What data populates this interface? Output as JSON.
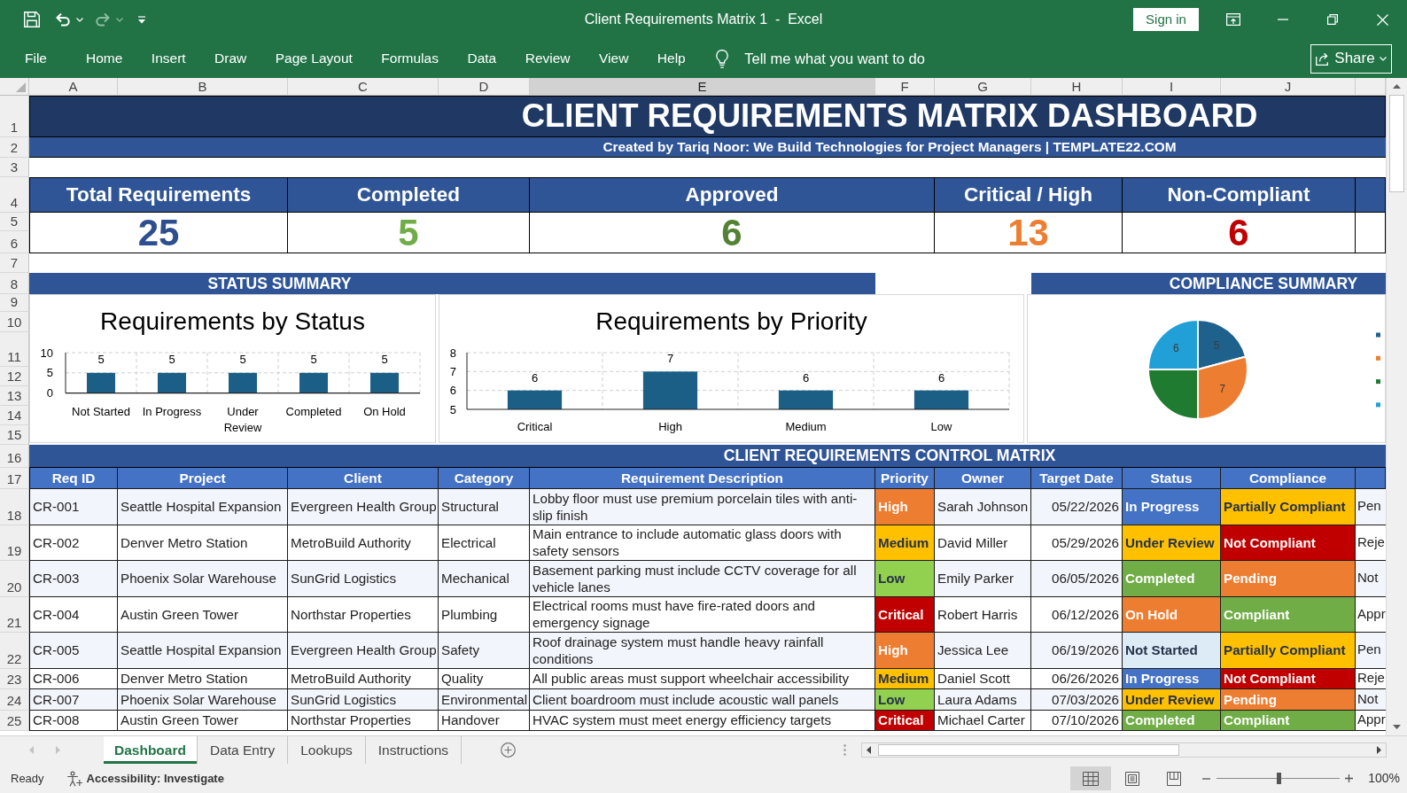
{
  "window": {
    "title": "Client Requirements Matrix 1  -  Excel",
    "sign_in": "Sign in"
  },
  "quick_access": [
    {
      "kind": "save",
      "disabled": false
    },
    {
      "kind": "undo",
      "disabled": false
    },
    {
      "kind": "redo",
      "disabled": true
    },
    {
      "kind": "customize",
      "disabled": false
    }
  ],
  "ribbon": {
    "tabs": [
      {
        "label": "File",
        "selected": false
      },
      {
        "label": "Home",
        "selected": false
      },
      {
        "label": "Insert",
        "selected": false
      },
      {
        "label": "Draw",
        "selected": false
      },
      {
        "label": "Page Layout",
        "selected": false
      },
      {
        "label": "Formulas",
        "selected": false
      },
      {
        "label": "Data",
        "selected": false
      },
      {
        "label": "Review",
        "selected": false
      },
      {
        "label": "View",
        "selected": false
      },
      {
        "label": "Help",
        "selected": false
      }
    ],
    "tell_me": "Tell me what you want to do",
    "share": "Share"
  },
  "sheet": {
    "column_headers": [
      {
        "label": "A",
        "selected": false
      },
      {
        "label": "B",
        "selected": false
      },
      {
        "label": "C",
        "selected": false
      },
      {
        "label": "D",
        "selected": false
      },
      {
        "label": "E",
        "selected": true
      },
      {
        "label": "F",
        "selected": false
      },
      {
        "label": "G",
        "selected": false
      },
      {
        "label": "H",
        "selected": false
      },
      {
        "label": "I",
        "selected": false
      },
      {
        "label": "J",
        "selected": false
      }
    ],
    "row_numbers": [
      "1",
      "2",
      "3",
      "4",
      "5",
      "6",
      "7",
      "8",
      "9",
      "10",
      "11",
      "12",
      "13",
      "14",
      "15",
      "16",
      "17",
      "18",
      "19",
      "20",
      "21",
      "22",
      "23",
      "24",
      "25"
    ],
    "title": "CLIENT REQUIREMENTS MATRIX DASHBOARD",
    "subtitle": "Created by Tariq Noor: We Build Technologies for Project Managers | TEMPLATE22.COM",
    "kpis": [
      {
        "label": "Total Requirements",
        "value": "25",
        "color": "#2e4f8f"
      },
      {
        "label": "Completed",
        "value": "5",
        "color": "#70ad47"
      },
      {
        "label": "Approved",
        "value": "6",
        "color": "#548235"
      },
      {
        "label": "Critical / High",
        "value": "13",
        "color": "#ed7d31"
      },
      {
        "label": "Non-Compliant",
        "value": "6",
        "color": "#c00000"
      }
    ],
    "status_summary": {
      "title": "STATUS SUMMARY",
      "status_chart": {
        "chart_data": {
          "type": "bar",
          "title": "Requirements by Status",
          "categories": [
            "Not Started",
            "In Progress",
            "Under Review",
            "Completed",
            "On Hold"
          ],
          "series": [
            {
              "color": "#1c5f86",
              "values": [
                5,
                5,
                5,
                5,
                5
              ]
            }
          ],
          "ylim": [
            0,
            10
          ],
          "yticks": [
            0,
            5,
            10
          ],
          "data_labels": true
        }
      },
      "priority_chart": {
        "chart_data": {
          "type": "bar",
          "title": "Requirements by Priority",
          "categories": [
            "Critical",
            "High",
            "Medium",
            "Low"
          ],
          "series": [
            {
              "color": "#1c5f86",
              "values": [
                6,
                7,
                6,
                6
              ]
            }
          ],
          "ylim": [
            5,
            8
          ],
          "yticks": [
            5,
            6,
            7,
            8
          ],
          "data_labels": true
        }
      }
    },
    "compliance_summary": {
      "title": "COMPLIANCE SUMMARY",
      "chart_data": {
        "type": "pie",
        "values": [
          5,
          7,
          6,
          6
        ],
        "data_labels": true,
        "value_labels": [
          "5",
          "7",
          null,
          "6"
        ]
      },
      "legend_markers": [
        {
          "color": "#1f618d"
        },
        {
          "color": "#ed7d31"
        },
        {
          "color": "#1e7b30"
        },
        {
          "color": "#21a0d8"
        }
      ]
    },
    "matrix": {
      "title": "CLIENT REQUIREMENTS CONTROL MATRIX",
      "columns": [
        "Req ID",
        "Project",
        "Client",
        "Category",
        "Requirement Description",
        "Priority",
        "Owner",
        "Target Date",
        "Status",
        "Compliance"
      ],
      "rows": [
        {
          "req_id": "CR-001",
          "project": "Seattle Hospital Expansion",
          "client": "Evergreen Health Group",
          "category": "Structural",
          "description": "Lobby floor must use premium porcelain tiles with anti-slip finish",
          "priority": {
            "text": "High",
            "color": "#ed7d31"
          },
          "owner": "Sarah Johnson",
          "target_date": "05/22/2026",
          "status": {
            "text": "In Progress",
            "color": "#4472c4"
          },
          "compliance": {
            "text": "Partially Compliant",
            "color": "#ffc000"
          },
          "column_11": "Pen"
        },
        {
          "req_id": "CR-002",
          "project": "Denver Metro Station",
          "client": "MetroBuild Authority",
          "category": "Electrical",
          "description": "Main entrance to include automatic glass doors with safety sensors",
          "priority": {
            "text": "Medium",
            "color": "#ffc000"
          },
          "owner": "David Miller",
          "target_date": "05/29/2026",
          "status": {
            "text": "Under Review",
            "color": "#ffc000"
          },
          "compliance": {
            "text": "Not Compliant",
            "color": "#c00000"
          },
          "column_11": "Reje"
        },
        {
          "req_id": "CR-003",
          "project": "Phoenix Solar Warehouse",
          "client": "SunGrid Logistics",
          "category": "Mechanical",
          "description": "Basement parking must include CCTV coverage for all vehicle lanes",
          "priority": {
            "text": "Low",
            "color": "#92d050"
          },
          "owner": "Emily Parker",
          "target_date": "06/05/2026",
          "status": {
            "text": "Completed",
            "color": "#70ad47"
          },
          "compliance": {
            "text": "Pending",
            "color": "#ed7d31"
          },
          "column_11": "Not"
        },
        {
          "req_id": "CR-004",
          "project": "Austin Green Tower",
          "client": "Northstar Properties",
          "category": "Plumbing",
          "description": "Electrical rooms must have fire-rated doors and emergency signage",
          "priority": {
            "text": "Critical",
            "color": "#c00000"
          },
          "owner": "Robert Harris",
          "target_date": "06/12/2026",
          "status": {
            "text": "On Hold",
            "color": "#ed7d31"
          },
          "compliance": {
            "text": "Compliant",
            "color": "#70ad47"
          },
          "column_11": "Appr"
        },
        {
          "req_id": "CR-005",
          "project": "Seattle Hospital Expansion",
          "client": "Evergreen Health Group",
          "category": "Safety",
          "description": "Roof drainage system must handle heavy rainfall conditions",
          "priority": {
            "text": "High",
            "color": "#ed7d31"
          },
          "owner": "Jessica Lee",
          "target_date": "06/19/2026",
          "status": {
            "text": "Not Started",
            "color": "#ddebf7"
          },
          "compliance": {
            "text": "Partially Compliant",
            "color": "#ffc000"
          },
          "column_11": "Pen"
        },
        {
          "req_id": "CR-006",
          "project": "Denver Metro Station",
          "client": "MetroBuild Authority",
          "category": "Quality",
          "description": "All public areas must support wheelchair accessibility",
          "priority": {
            "text": "Medium",
            "color": "#ffc000"
          },
          "owner": "Daniel Scott",
          "target_date": "06/26/2026",
          "status": {
            "text": "In Progress",
            "color": "#4472c4"
          },
          "compliance": {
            "text": "Not Compliant",
            "color": "#c00000"
          },
          "column_11": "Reje"
        },
        {
          "req_id": "CR-007",
          "project": "Phoenix Solar Warehouse",
          "client": "SunGrid Logistics",
          "category": "Environmental",
          "description": "Client boardroom must include acoustic wall panels",
          "priority": {
            "text": "Low",
            "color": "#92d050"
          },
          "owner": "Laura Adams",
          "target_date": "07/03/2026",
          "status": {
            "text": "Under Review",
            "color": "#ffc000"
          },
          "compliance": {
            "text": "Pending",
            "color": "#ed7d31"
          },
          "column_11": "Not"
        },
        {
          "req_id": "CR-008",
          "project": "Austin Green Tower",
          "client": "Northstar Properties",
          "category": "Handover",
          "description": "HVAC system must meet energy efficiency targets",
          "priority": {
            "text": "Critical",
            "color": "#c00000"
          },
          "owner": "Michael Carter",
          "target_date": "07/10/2026",
          "status": {
            "text": "Completed",
            "color": "#70ad47"
          },
          "compliance": {
            "text": "Compliant",
            "color": "#70ad47"
          },
          "column_11": "Appr"
        }
      ]
    }
  },
  "sheet_tabs": [
    {
      "label": "Dashboard",
      "selected": true
    },
    {
      "label": "Data Entry",
      "selected": false
    },
    {
      "label": "Lookups",
      "selected": false
    },
    {
      "label": "Instructions",
      "selected": false
    }
  ],
  "status_bar": {
    "ready": "Ready",
    "accessibility": "Accessibility: Investigate",
    "views": [
      {
        "kind": "normal",
        "selected": true
      },
      {
        "kind": "page_layout",
        "selected": false
      },
      {
        "kind": "page_break",
        "selected": false
      }
    ],
    "zoom": {
      "level": 0.5,
      "percent": "100%"
    }
  }
}
